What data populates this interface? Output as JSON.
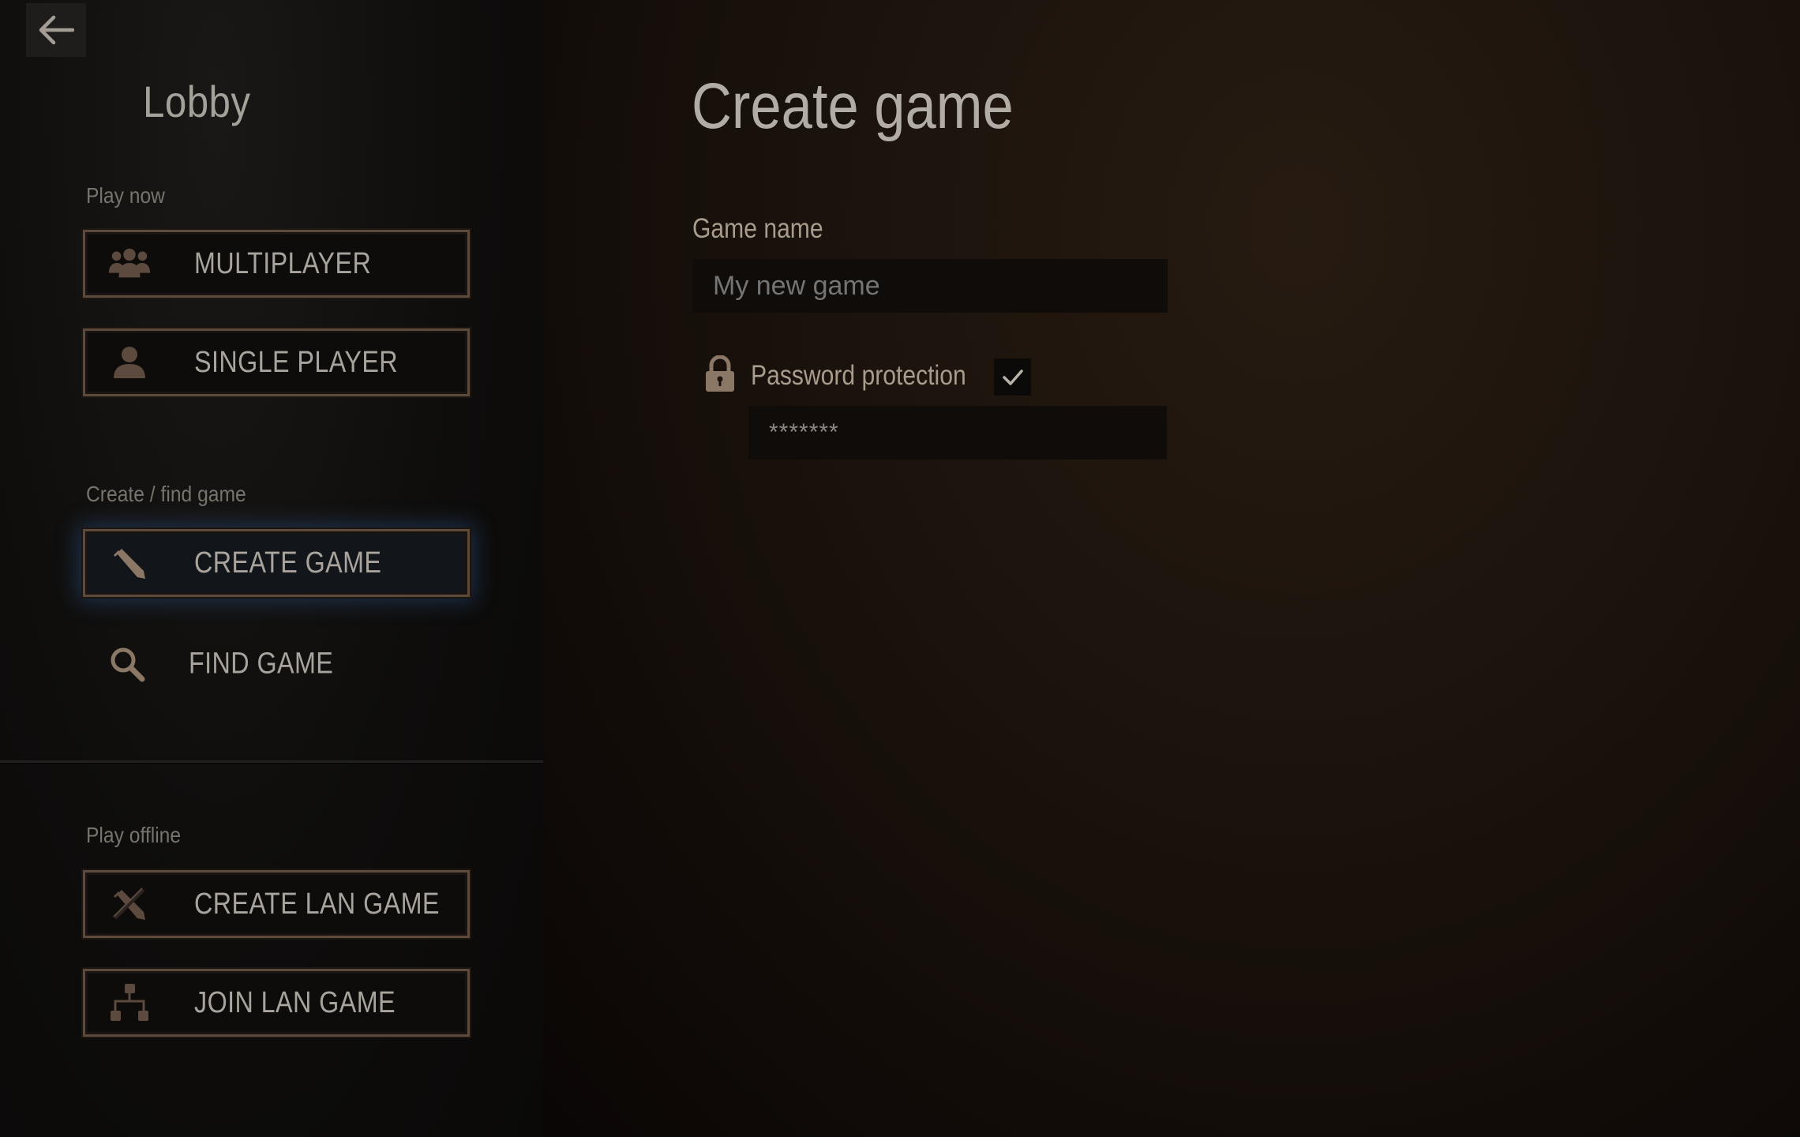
{
  "sidebar": {
    "title": "Lobby",
    "back_icon": "arrow-left-icon",
    "sections": {
      "play_now": "Play now",
      "create_find": "Create / find game",
      "play_offline": "Play offline"
    },
    "buttons": {
      "multiplayer": {
        "label": "MULTIPLAYER",
        "icon": "users-icon"
      },
      "single_player": {
        "label": "SINGLE PLAYER",
        "icon": "user-icon"
      },
      "create_game": {
        "label": "CREATE GAME",
        "icon": "pencil-icon",
        "selected": true
      },
      "find_game": {
        "label": "FIND GAME",
        "icon": "search-icon"
      },
      "create_lan_game": {
        "label": "CREATE LAN GAME",
        "icon": "pencil-crossed-icon"
      },
      "join_lan_game": {
        "label": "JOIN LAN GAME",
        "icon": "network-icon"
      }
    }
  },
  "main": {
    "title": "Create game",
    "game_name": {
      "label": "Game name",
      "placeholder": "My new game",
      "value": ""
    },
    "password": {
      "label": "Password protection",
      "checked": true,
      "value": "*******",
      "lock_icon": "lock-icon",
      "check_icon": "checkmark-icon"
    }
  },
  "colors": {
    "accent_glow": "#305a96",
    "button_border": "#5e4a3b",
    "text": "#a8a39c",
    "icon": "#8a7766"
  }
}
